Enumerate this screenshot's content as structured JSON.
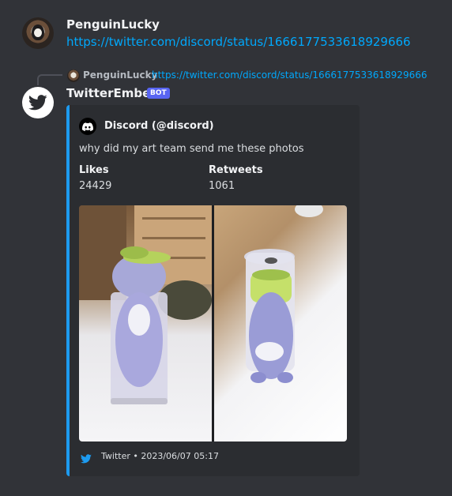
{
  "messages": [
    {
      "username": "PenguinLucky",
      "content_link": "https://twitter.com/discord/status/1666177533618929666"
    },
    {
      "reply": {
        "username": "PenguinLucky",
        "link": "https://twitter.com/discord/status/1666177533618929666"
      },
      "username": "TwitterEmbed",
      "badge": "BOT",
      "avatar_icon": "twitter-bird-icon",
      "embed": {
        "accent_color": "#1d9bf0",
        "author": "Discord (@discord)",
        "author_icon": "discord-logo-icon",
        "description": "why did my art team send me these photos",
        "fields": [
          {
            "name": "Likes",
            "value": "24429"
          },
          {
            "name": "Retweets",
            "value": "1061"
          }
        ],
        "images": [
          "photo-plush-in-cup-1",
          "photo-plush-in-cup-2"
        ],
        "footer": {
          "icon": "twitter-bird-icon",
          "text": "Twitter • 2023/06/07 05:17"
        }
      }
    }
  ],
  "colors": {
    "background": "#313338",
    "embed_background": "#2b2d31",
    "link": "#00a8fc",
    "bot_badge": "#5865f2"
  }
}
